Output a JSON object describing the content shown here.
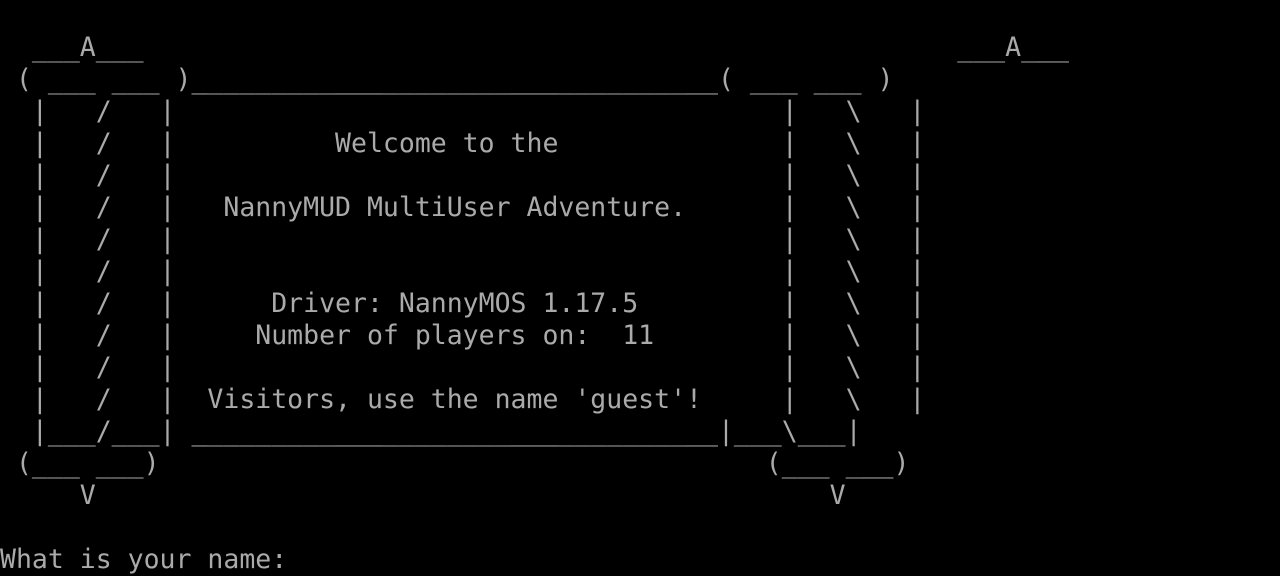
{
  "terminal": {
    "colors": {
      "background": "#000000",
      "foreground": "#aaaaaa"
    },
    "banner": [
      "  ___A___                                                   ___A___",
      " ( ___ ___ )_________________________________( ___ ___ )",
      "  |   /   |                                      |   \\   |",
      "  |   /   |          Welcome to the              |   \\   |",
      "  |   /   |                                      |   \\   |",
      "  |   /   |   NannyMUD MultiUser Adventure.      |   \\   |",
      "  |   /   |                                      |   \\   |",
      "  |   /   |                                      |   \\   |",
      "  |   /   |      Driver: NannyMOS 1.17.5         |   \\   |",
      "  |   /   |     Number of players on:  11        |   \\   |",
      "  |   /   |                                      |   \\   |",
      "  |   /   |  Visitors, use the name 'guest'!     |   \\   |",
      "  |___/___| _________________________________|___\\___|",
      " (___ ___)                                      (___ ___)",
      "     V                                              V"
    ],
    "prompt": "What is your name: ",
    "input_value": ""
  }
}
